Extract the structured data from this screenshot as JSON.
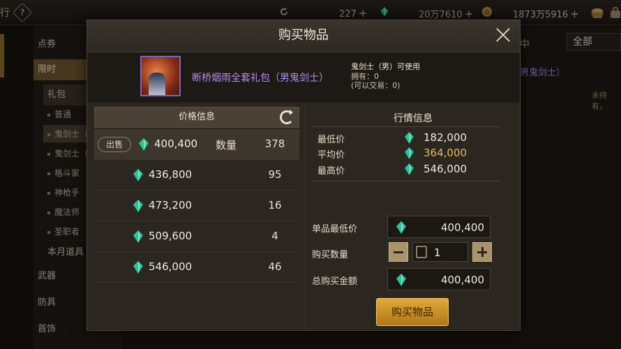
{
  "topbar": {
    "left_fragment": "行",
    "help_glyph": "?",
    "currencies": [
      {
        "icon": "refresh-coin-icon",
        "value": "227"
      },
      {
        "icon": "gem-icon",
        "value": "20万7610"
      },
      {
        "icon": "gold-coin-icon",
        "value": "1873万5916"
      }
    ],
    "plus_glyph": "+"
  },
  "sidebar": {
    "items": [
      {
        "label": "点券"
      },
      {
        "label": "限时"
      },
      {
        "label": "礼包"
      },
      {
        "label": "普通"
      },
      {
        "label": "鬼剑士（"
      },
      {
        "label": "鬼剑士（"
      },
      {
        "label": "格斗家"
      },
      {
        "label": "神枪手"
      },
      {
        "label": "魔法师"
      },
      {
        "label": "圣职者"
      },
      {
        "label": "本月道具"
      },
      {
        "label": "武器"
      },
      {
        "label": "防具"
      },
      {
        "label": "首饰"
      }
    ]
  },
  "background_right": {
    "col_header_fragment": "中",
    "filter_value": "全部",
    "item_name_fragment": "男鬼剑士）",
    "hold_status": "未持有，"
  },
  "modal": {
    "title": "购买物品",
    "item": {
      "name": "断桥烟雨全套礼包（男鬼剑士）",
      "usable_by": "鬼剑士（男）可使用",
      "owned": "拥有：0",
      "tradable": "(可以交易：0)"
    },
    "price_panel": {
      "header": "价格信息",
      "sell_label": "出售",
      "qty_label": "数量",
      "rows": [
        {
          "price": "400,400",
          "qty": "378"
        },
        {
          "price": "436,800",
          "qty": "95"
        },
        {
          "price": "473,200",
          "qty": "16"
        },
        {
          "price": "509,600",
          "qty": "4"
        },
        {
          "price": "546,000",
          "qty": "46"
        }
      ]
    },
    "market": {
      "title": "行情信息",
      "min_label": "最低价",
      "min_value": "182,000",
      "avg_label": "平均价",
      "avg_value": "364,000",
      "max_label": "最高价",
      "max_value": "546,000"
    },
    "form": {
      "unit_min_label": "单品最低价",
      "unit_min_value": "400,400",
      "buy_qty_label": "购买数量",
      "buy_qty_value": "1",
      "total_label": "总购买金额",
      "total_value": "400,400"
    },
    "buy_button": "购买物品"
  },
  "colors": {
    "gem": "#2fbf9a",
    "accent_gold": "#d89a2c",
    "item_name_purple": "#b48df0",
    "avg_price": "#e8b85c"
  }
}
